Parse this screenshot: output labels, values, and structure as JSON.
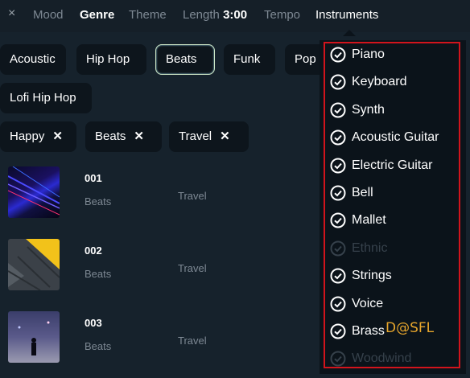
{
  "topbar": {
    "close_icon": "×",
    "mood": "Mood",
    "genre": "Genre",
    "theme": "Theme",
    "length_label": "Length",
    "length_value": "3:00",
    "tempo": "Tempo",
    "instruments": "Instruments"
  },
  "genres": [
    {
      "label": "Acoustic",
      "selected": false
    },
    {
      "label": "Hip Hop",
      "selected": false
    },
    {
      "label": "Beats",
      "selected": true
    },
    {
      "label": "Funk",
      "selected": false
    },
    {
      "label": "Pop",
      "selected": false
    },
    {
      "label": "Lofi Hip Hop",
      "selected": false
    }
  ],
  "active_filters": [
    {
      "label": "Happy",
      "remove_icon": "✕"
    },
    {
      "label": "Beats",
      "remove_icon": "✕"
    },
    {
      "label": "Travel",
      "remove_icon": "✕"
    }
  ],
  "tracks": [
    {
      "number": "001",
      "genre": "Beats",
      "mood": "Travel",
      "thumb_icon": "blue-light-streaks-image"
    },
    {
      "number": "002",
      "genre": "Beats",
      "mood": "Travel",
      "thumb_icon": "yellow-paving-image"
    },
    {
      "number": "003",
      "genre": "Beats",
      "mood": "Travel",
      "thumb_icon": "night-figure-image"
    }
  ],
  "instruments_menu": [
    {
      "label": "Piano",
      "enabled": true
    },
    {
      "label": "Keyboard",
      "enabled": true
    },
    {
      "label": "Synth",
      "enabled": true
    },
    {
      "label": "Acoustic Guitar",
      "enabled": true
    },
    {
      "label": "Electric Guitar",
      "enabled": true
    },
    {
      "label": "Bell",
      "enabled": true
    },
    {
      "label": "Mallet",
      "enabled": true
    },
    {
      "label": "Ethnic",
      "enabled": false
    },
    {
      "label": "Strings",
      "enabled": true
    },
    {
      "label": "Voice",
      "enabled": true
    },
    {
      "label": "Brass",
      "enabled": true
    },
    {
      "label": "Woodwind",
      "enabled": false
    }
  ],
  "watermark": "D@SFL",
  "colors": {
    "background": "#16222c",
    "highlight_outline": "#d2141c",
    "watermark": "#e6a52c",
    "chip_bg": "#0d151c"
  }
}
